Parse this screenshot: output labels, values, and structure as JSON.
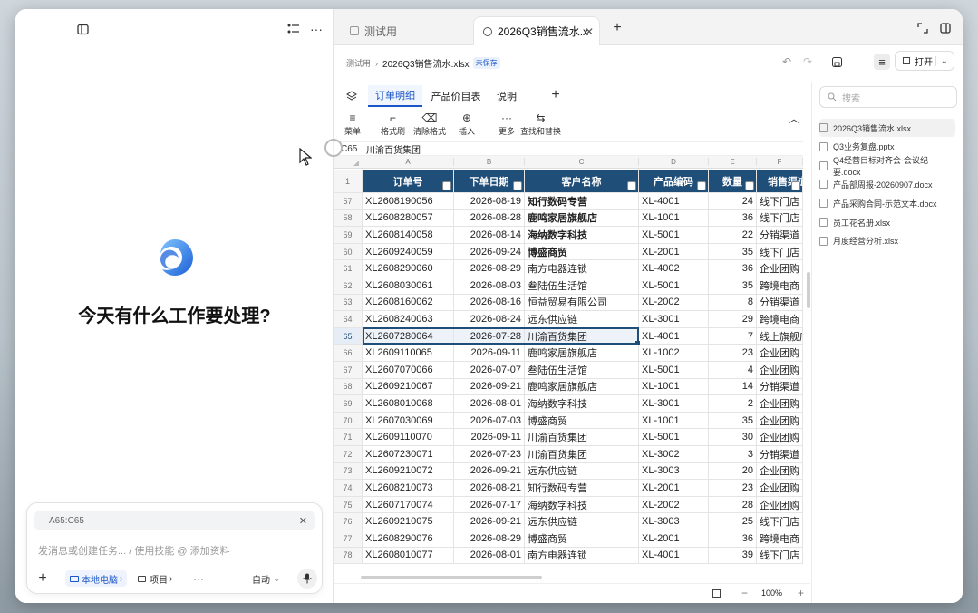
{
  "left": {
    "greeting": "今天有什么工作要处理?",
    "chat": {
      "chip": "A65:C65",
      "placeholder": "发消息或创建任务... / 使用技能 @ 添加资料",
      "local": "本地电脑",
      "project": "项目",
      "auto": "自动"
    }
  },
  "tabs": [
    {
      "label": "测试用"
    },
    {
      "label": "2026Q3销售流水.xlsx"
    }
  ],
  "breadcrumb": {
    "root": "测试用",
    "file": "2026Q3销售流水.xlsx",
    "badge": "未保存"
  },
  "open_label": "打开",
  "sheet_tabs": [
    "订单明细",
    "产品价目表",
    "说明"
  ],
  "toolbar": [
    {
      "label": "菜单",
      "glyph": "≡",
      "icon": "menu-icon"
    },
    {
      "label": "格式刷",
      "glyph": "⌐",
      "icon": "format-brush-icon"
    },
    {
      "label": "清除格式",
      "glyph": "⌫",
      "icon": "eraser-icon"
    },
    {
      "label": "插入",
      "glyph": "⊕",
      "icon": "insert-icon"
    },
    {
      "label": "更多",
      "glyph": "···",
      "icon": "more-icon"
    },
    {
      "label": "查找和替换",
      "glyph": "⇆",
      "icon": "find-replace-icon"
    }
  ],
  "formula": {
    "ref": "C65",
    "value": "川渝百货集团"
  },
  "columns": [
    "A",
    "B",
    "C",
    "D",
    "E",
    "F"
  ],
  "headers": [
    "订单号",
    "下单日期",
    "客户名称",
    "产品编码",
    "数量",
    "销售渠道"
  ],
  "rows": [
    [
      "57",
      "XL2608190056",
      "2026-08-19",
      "知行数码专营",
      "XL-4001",
      "24",
      "线下门店"
    ],
    [
      "58",
      "XL2608280057",
      "2026-08-28",
      "鹿鸣家居旗舰店",
      "XL-1001",
      "36",
      "线下门店"
    ],
    [
      "59",
      "XL2608140058",
      "2026-08-14",
      "海纳数字科技",
      "XL-5001",
      "22",
      "分销渠道"
    ],
    [
      "60",
      "XL2609240059",
      "2026-09-24",
      "博盛商贸",
      "XL-2001",
      "35",
      "线下门店"
    ],
    [
      "61",
      "XL2608290060",
      "2026-08-29",
      "南方电器连锁",
      "XL-4002",
      "36",
      "企业团购"
    ],
    [
      "62",
      "XL2608030061",
      "2026-08-03",
      "叁陆伍生活馆",
      "XL-5001",
      "35",
      "跨境电商"
    ],
    [
      "63",
      "XL2608160062",
      "2026-08-16",
      "恒益贸易有限公司",
      "XL-2002",
      "8",
      "分销渠道"
    ],
    [
      "64",
      "XL2608240063",
      "2026-08-24",
      "远东供应链",
      "XL-3001",
      "29",
      "跨境电商"
    ],
    [
      "65",
      "XL2607280064",
      "2026-07-28",
      "川渝百货集团",
      "XL-4001",
      "7",
      "线上旗舰店"
    ],
    [
      "66",
      "XL2609110065",
      "2026-09-11",
      "鹿鸣家居旗舰店",
      "XL-1002",
      "23",
      "企业团购"
    ],
    [
      "67",
      "XL2607070066",
      "2026-07-07",
      "叁陆伍生活馆",
      "XL-5001",
      "4",
      "企业团购"
    ],
    [
      "68",
      "XL2609210067",
      "2026-09-21",
      "鹿鸣家居旗舰店",
      "XL-1001",
      "14",
      "分销渠道"
    ],
    [
      "69",
      "XL2608010068",
      "2026-08-01",
      "海纳数字科技",
      "XL-3001",
      "2",
      "企业团购"
    ],
    [
      "70",
      "XL2607030069",
      "2026-07-03",
      "博盛商贸",
      "XL-1001",
      "35",
      "企业团购"
    ],
    [
      "71",
      "XL2609110070",
      "2026-09-11",
      "川渝百货集团",
      "XL-5001",
      "30",
      "企业团购"
    ],
    [
      "72",
      "XL2607230071",
      "2026-07-23",
      "川渝百货集团",
      "XL-3002",
      "3",
      "分销渠道"
    ],
    [
      "73",
      "XL2609210072",
      "2026-09-21",
      "远东供应链",
      "XL-3003",
      "20",
      "企业团购"
    ],
    [
      "74",
      "XL2608210073",
      "2026-08-21",
      "知行数码专营",
      "XL-2001",
      "23",
      "企业团购"
    ],
    [
      "75",
      "XL2607170074",
      "2026-07-17",
      "海纳数字科技",
      "XL-2002",
      "28",
      "企业团购"
    ],
    [
      "76",
      "XL2609210075",
      "2026-09-21",
      "远东供应链",
      "XL-3003",
      "25",
      "线下门店"
    ],
    [
      "77",
      "XL2608290076",
      "2026-08-29",
      "博盛商贸",
      "XL-2001",
      "36",
      "跨境电商"
    ],
    [
      "78",
      "XL2608010077",
      "2026-08-01",
      "南方电器连锁",
      "XL-4001",
      "39",
      "线下门店"
    ]
  ],
  "bold_rows": [
    "57",
    "58",
    "59",
    "60"
  ],
  "selected_row": "65",
  "files": {
    "search_placeholder": "搜索",
    "items": [
      "2026Q3销售流水.xlsx",
      "Q3业务复盘.pptx",
      "Q4经营目标对齐会-会议纪要.docx",
      "产品部周报-20260907.docx",
      "产品采购合同-示范文本.docx",
      "员工花名册.xlsx",
      "月度经营分析.xlsx"
    ]
  },
  "zoom": "100%",
  "colors": {
    "header_fill": "#1f4e79",
    "accent": "#1a73e8",
    "selection": "#1f4e79"
  }
}
